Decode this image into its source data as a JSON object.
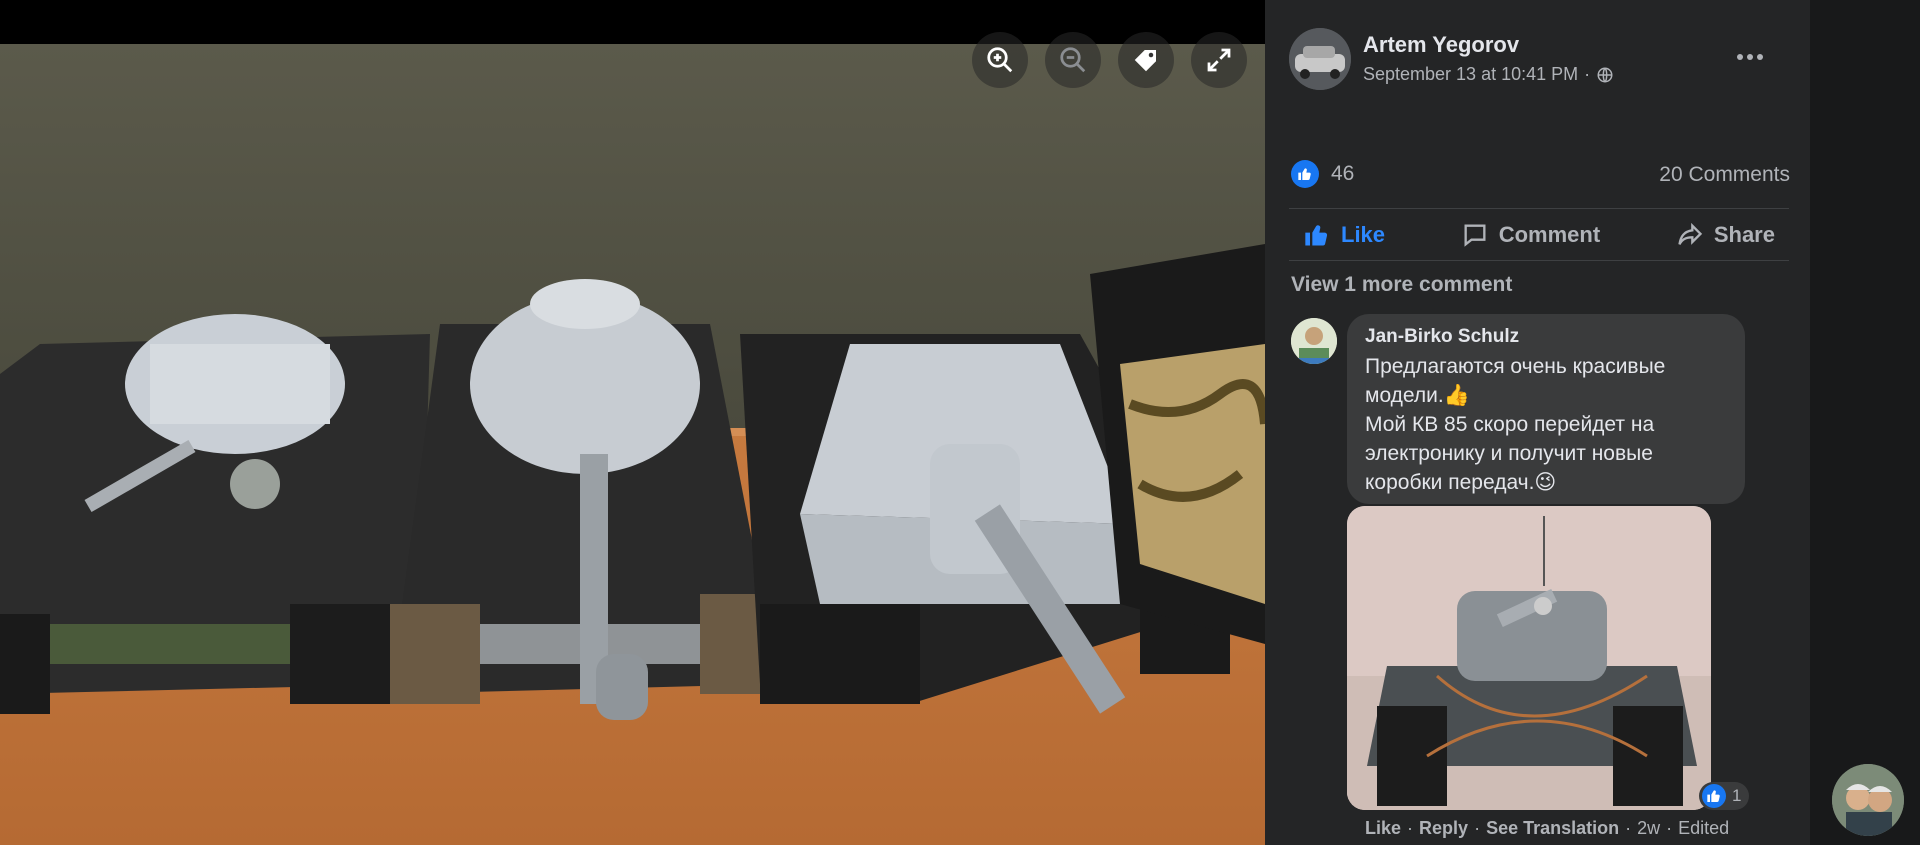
{
  "viewer": {
    "toolbar": [
      {
        "name": "zoom-in-button",
        "icon": "zoom-in-icon"
      },
      {
        "name": "zoom-out-button",
        "icon": "zoom-out-icon"
      },
      {
        "name": "tag-button",
        "icon": "tag-icon"
      },
      {
        "name": "fullscreen-button",
        "icon": "fullscreen-icon"
      }
    ],
    "photo_subject": "four model tanks on wooden shelf"
  },
  "post": {
    "author": "Artem Yegorov",
    "timestamp": "September 13 at 10:41 PM",
    "separator": "·",
    "privacy_icon": "globe-icon",
    "reaction_count": "46",
    "comment_count": "20 Comments",
    "actions": {
      "like": "Like",
      "comment": "Comment",
      "share": "Share"
    },
    "view_more": "View 1 more comment"
  },
  "comment": {
    "author": "Jan-Birko Schulz",
    "text": "Предлагаются очень красивые модели.👍\nМой КВ 85 скоро перейдет на электронику и получит новые коробки передач.😉",
    "photo_reaction_count": "1",
    "actions": {
      "like": "Like",
      "reply": "Reply",
      "see_translation": "See Translation",
      "time": "2w",
      "edited": "Edited",
      "dot": "·"
    }
  },
  "colors": {
    "panel_bg": "#242526",
    "rail_bg": "#18191a",
    "accent": "#2d88ff",
    "like_blue": "#1877f2",
    "text_primary": "#e4e6eb",
    "text_secondary": "#b0b3b8",
    "bubble": "#3a3b3c"
  }
}
